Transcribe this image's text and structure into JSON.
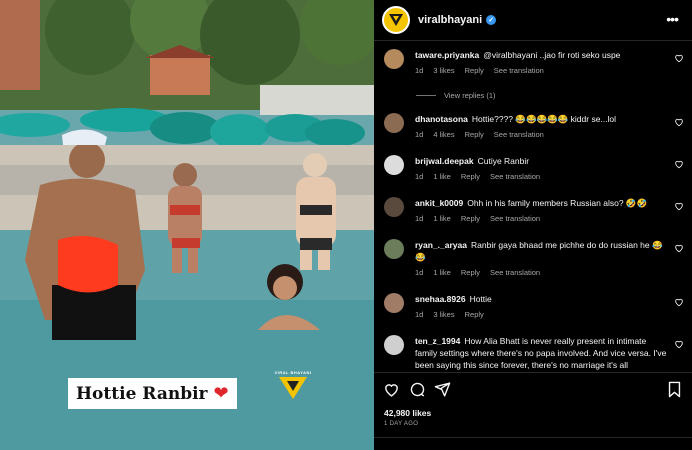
{
  "photo": {
    "caption": "Hottie Ranbir",
    "caption_emoji": "❤",
    "watermark": "VIRAL BHAYANI"
  },
  "post": {
    "username": "viralbhayani",
    "verified": true,
    "likes": "42,980 likes",
    "time_ago": "1 DAY AGO"
  },
  "view_replies": "View replies (1)",
  "comments": [
    {
      "user": "taware.priyanka",
      "text": "@viralbhayani ..jao fir roti seko uspe",
      "time": "1d",
      "likes": "3 likes",
      "reply": "Reply",
      "translate": "See translation",
      "avatar_color": "#b58a5c"
    },
    {
      "user": "dhanotasona",
      "text": "Hottie???? 😂😂😂😂😂 kiddr se...lol",
      "time": "1d",
      "likes": "4 likes",
      "reply": "Reply",
      "translate": "See translation",
      "avatar_color": "#8b6b52"
    },
    {
      "user": "brijwal.deepak",
      "text": "Cutiye Ranbir",
      "time": "1d",
      "likes": "1 like",
      "reply": "Reply",
      "translate": "See translation",
      "avatar_color": "#dcdcdc"
    },
    {
      "user": "ankit_k0009",
      "text": "Ohh in his family members Russian also? 🤣🤣",
      "time": "1d",
      "likes": "1 like",
      "reply": "Reply",
      "translate": "See translation",
      "avatar_color": "#5a4a3e"
    },
    {
      "user": "ryan_._aryaa",
      "text": "Ranbir gaya bhaad me pichhe do do russian he 😂😂",
      "time": "1d",
      "likes": "1 like",
      "reply": "Reply",
      "translate": "See translation",
      "avatar_color": "#6b7d5a"
    },
    {
      "user": "snehaa.8926",
      "text": "Hottie",
      "time": "1d",
      "likes": "3 likes",
      "reply": "Reply",
      "translate": "",
      "avatar_color": "#a07c66"
    },
    {
      "user": "ten_z_1994",
      "text": "How Alia Bhatt is never really present in intimate family settings where there's no papa involved. And vice versa. I've been saying this since forever, there's no marriage it's all",
      "time": "",
      "likes": "",
      "reply": "",
      "translate": "",
      "avatar_color": "#cfcfcf"
    }
  ]
}
